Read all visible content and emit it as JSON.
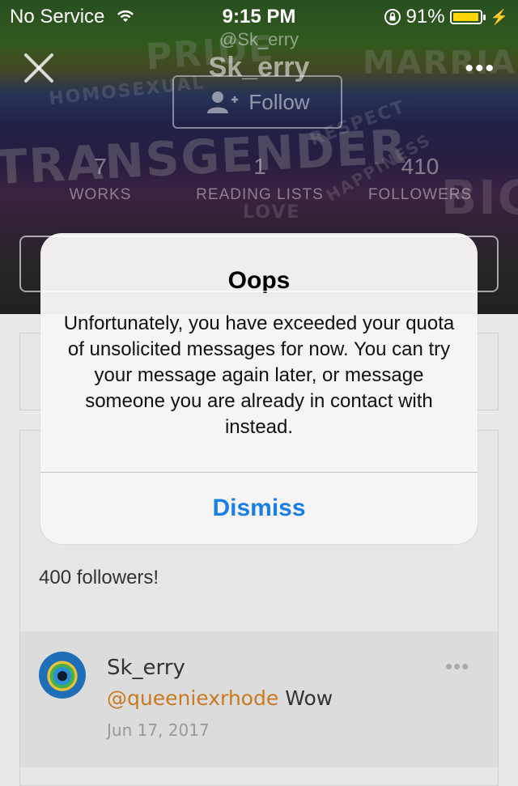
{
  "status_bar": {
    "carrier": "No Service",
    "time": "9:15 PM",
    "battery_percent": "91%",
    "battery_level": 0.91,
    "battery_color": "#ffd60a"
  },
  "profile": {
    "handle": "@Sk_erry",
    "username": "Sk_erry",
    "follow_label": "Follow",
    "stats": [
      {
        "value": "7",
        "label": "WORKS"
      },
      {
        "value": "1",
        "label": "READING LISTS"
      },
      {
        "value": "410",
        "label": "FOLLOWERS"
      }
    ]
  },
  "banner_words": [
    "PRIDE",
    "MARRIAGE",
    "HOMOSEXUAL",
    "TRANSGENDER",
    "BIG",
    "RESPECT",
    "HAPPINESS",
    "LOVE"
  ],
  "feed": {
    "post_text": "400 followers!",
    "reply": {
      "author": "Sk_erry",
      "mention": "@queeniexrhode",
      "text": "Wow",
      "date": "Jun 17, 2017"
    }
  },
  "alert": {
    "title": "Oops",
    "message": "Unfortunately, you have exceeded your quota of unsolicited messages for now. You can try your message again later, or message someone you are already in contact with instead.",
    "dismiss_label": "Dismiss",
    "button_color": "#1a7fe3"
  },
  "colors": {
    "mention": "#c87a22"
  }
}
